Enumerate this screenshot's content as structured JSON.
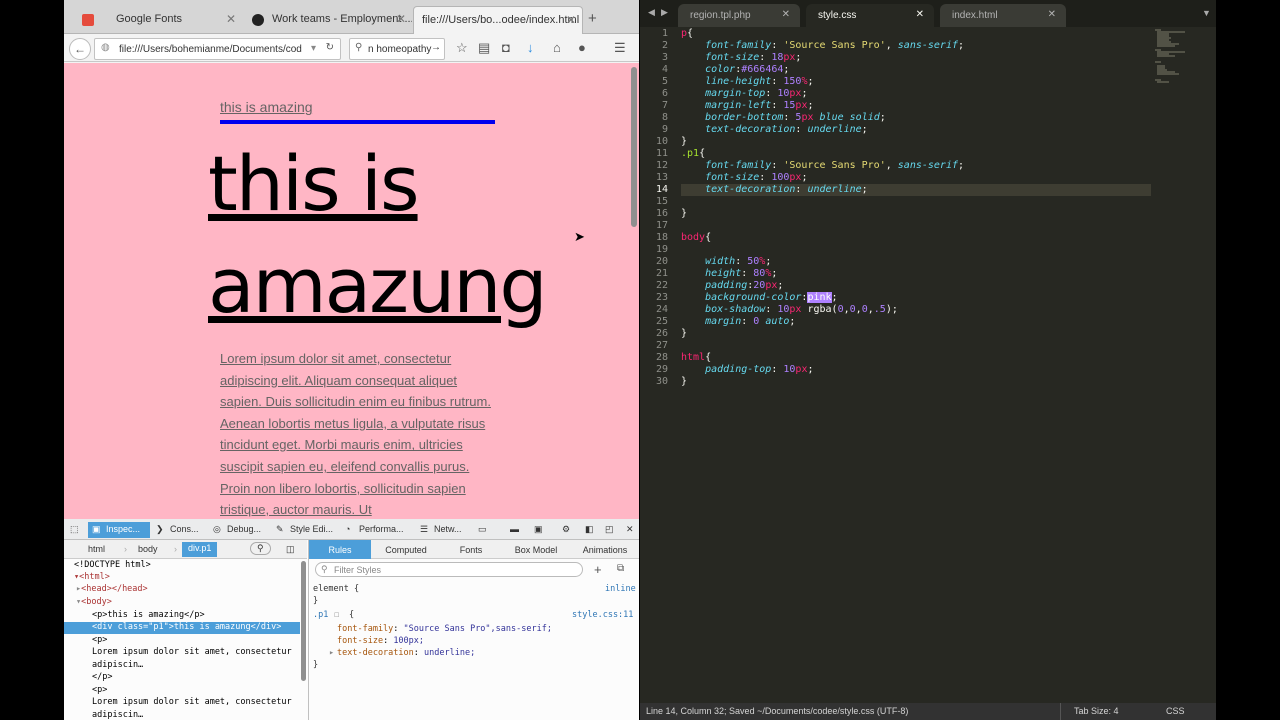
{
  "browser": {
    "tabs": [
      {
        "title": "Google Fonts"
      },
      {
        "title": "Work teams - Employment ..."
      },
      {
        "title": "file:///Users/bo...odee/index.html"
      }
    ],
    "url": "file:///Users/bohemianme/Documents/cod",
    "search": "n homeopathy"
  },
  "page": {
    "p_text": "this is amazing",
    "big_text": "this is amazung",
    "lorem": "Lorem ipsum dolor sit amet, consectetur adipiscing elit. Aliquam consequat aliquet sapien. Duis sollicitudin enim eu finibus rutrum. Aenean lobortis metus ligula, a vulputate risus tincidunt eget. Morbi mauris enim, ultricies suscipit sapien eu, eleifend convallis purus. Proin non libero lobortis, sollicitudin sapien tristique, auctor mauris. Ut"
  },
  "devtools": {
    "tools": [
      "Inspec...",
      "Cons...",
      "Debug...",
      "Style Edi...",
      "Performa...",
      "Netw..."
    ],
    "breadcrumbs": [
      "html",
      "body",
      "div.p1"
    ],
    "markup": [
      "<!DOCTYPE html>",
      "<html>",
      "<head></head>",
      "<body>",
      "<p>this is amazing</p>",
      "<div class=\"p1\">this is amazung</div>",
      "<p>",
      "Lorem ipsum dolor sit amet, consectetur",
      "adipiscin…",
      "</p>",
      "<p>",
      "Lorem ipsum dolor sit amet, consectetur",
      "adipiscin…"
    ],
    "rule_tabs": [
      "Rules",
      "Computed",
      "Fonts",
      "Box Model",
      "Animations"
    ],
    "filter_placeholder": "Filter Styles",
    "element_rule": "element {",
    "element_close": "}",
    "inline_label": "inline",
    "p1_selector": ".p1",
    "p1_open": "{",
    "p1_source": "style.css:11",
    "p1_props": [
      {
        "name": "font-family",
        "value": "\"Source Sans Pro\",sans-serif;"
      },
      {
        "name": "font-size",
        "value": "100px;"
      },
      {
        "name": "text-decoration",
        "value": "underline;"
      }
    ],
    "p1_close": "}"
  },
  "editor": {
    "tabs": [
      "region.tpl.php",
      "style.css",
      "index.html"
    ],
    "active_tab": 1,
    "line_numbers": [
      "1",
      "2",
      "3",
      "4",
      "5",
      "6",
      "7",
      "8",
      "9",
      "10",
      "11",
      "12",
      "13",
      "14",
      "15",
      "16",
      "17",
      "18",
      "19",
      "20",
      "21",
      "22",
      "23",
      "24",
      "25",
      "26",
      "27",
      "28",
      "29",
      "30"
    ],
    "status": "Line 14, Column 32; Saved ~/Documents/codee/style.css (UTF-8)",
    "tab_size": "Tab Size: 4",
    "syntax": "CSS"
  }
}
